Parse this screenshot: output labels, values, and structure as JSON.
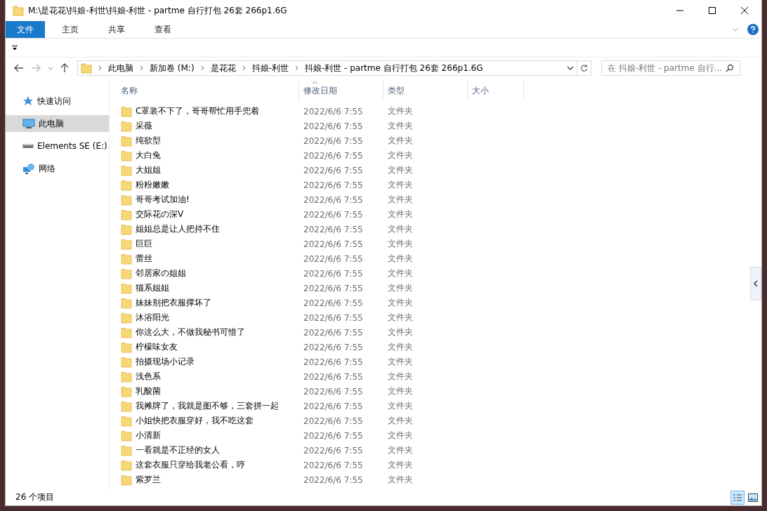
{
  "window": {
    "title": "M:\\是花花\\抖娘-利世\\抖娘-利世 - partme 自行打包 26套 266p1.6G"
  },
  "ribbon": {
    "tabs": [
      {
        "label": "文件",
        "selected": true
      },
      {
        "label": "主页",
        "selected": false
      },
      {
        "label": "共享",
        "selected": false
      },
      {
        "label": "查看",
        "selected": false
      }
    ]
  },
  "address": {
    "crumbs": [
      "此电脑",
      "新加卷 (M:)",
      "是花花",
      "抖娘-利世",
      "抖娘-利世 - partme 自行打包 26套 266p1.6G"
    ]
  },
  "search": {
    "placeholder": "在 抖娘-利世 - partme 自行..."
  },
  "sidebar": {
    "items": [
      {
        "label": "快速访问",
        "kind": "star",
        "selected": false
      },
      {
        "label": "此电脑",
        "kind": "pc",
        "selected": true
      },
      {
        "label": "Elements SE (E:)",
        "kind": "drive",
        "selected": false
      },
      {
        "label": "网络",
        "kind": "network",
        "selected": false
      }
    ]
  },
  "table": {
    "columns": [
      "名称",
      "修改日期",
      "类型",
      "大小"
    ],
    "rows": [
      {
        "name": "C罩装不下了，哥哥帮忙用手兜着",
        "date": "2022/6/6 7:55",
        "type": "文件夹"
      },
      {
        "name": "采薇",
        "date": "2022/6/6 7:55",
        "type": "文件夹"
      },
      {
        "name": "纯欲型",
        "date": "2022/6/6 7:55",
        "type": "文件夹"
      },
      {
        "name": "大白兔",
        "date": "2022/6/6 7:55",
        "type": "文件夹"
      },
      {
        "name": "大姐姐",
        "date": "2022/6/6 7:55",
        "type": "文件夹"
      },
      {
        "name": "粉粉嫩嫩",
        "date": "2022/6/6 7:55",
        "type": "文件夹"
      },
      {
        "name": "哥哥考试加油!",
        "date": "2022/6/6 7:55",
        "type": "文件夹"
      },
      {
        "name": "交际花の深V",
        "date": "2022/6/6 7:55",
        "type": "文件夹"
      },
      {
        "name": "姐姐总是让人把持不住",
        "date": "2022/6/6 7:55",
        "type": "文件夹"
      },
      {
        "name": "巨巨",
        "date": "2022/6/6 7:55",
        "type": "文件夹"
      },
      {
        "name": "蕾丝",
        "date": "2022/6/6 7:55",
        "type": "文件夹"
      },
      {
        "name": "邻居家の姐姐",
        "date": "2022/6/6 7:55",
        "type": "文件夹"
      },
      {
        "name": "猫系姐姐",
        "date": "2022/6/6 7:55",
        "type": "文件夹"
      },
      {
        "name": "妹妹别把衣服撑坏了",
        "date": "2022/6/6 7:55",
        "type": "文件夹"
      },
      {
        "name": "沐浴阳光",
        "date": "2022/6/6 7:55",
        "type": "文件夹"
      },
      {
        "name": "你这么大，不做我秘书可惜了",
        "date": "2022/6/6 7:55",
        "type": "文件夹"
      },
      {
        "name": "柠檬味女友",
        "date": "2022/6/6 7:55",
        "type": "文件夹"
      },
      {
        "name": "拍摄现场小记录",
        "date": "2022/6/6 7:55",
        "type": "文件夹"
      },
      {
        "name": "浅色系",
        "date": "2022/6/6 7:55",
        "type": "文件夹"
      },
      {
        "name": "乳酸菌",
        "date": "2022/6/6 7:55",
        "type": "文件夹"
      },
      {
        "name": "我摊牌了，我就是图不够，三套拼一起",
        "date": "2022/6/6 7:55",
        "type": "文件夹"
      },
      {
        "name": "小姐快把衣服穿好，我不吃这套",
        "date": "2022/6/6 7:55",
        "type": "文件夹"
      },
      {
        "name": "小清新",
        "date": "2022/6/6 7:55",
        "type": "文件夹"
      },
      {
        "name": "一看就是不正经的女人",
        "date": "2022/6/6 7:55",
        "type": "文件夹"
      },
      {
        "name": "这套衣服只穿给我老公看，哼",
        "date": "2022/6/6 7:55",
        "type": "文件夹"
      },
      {
        "name": "紫罗兰",
        "date": "2022/6/6 7:55",
        "type": "文件夹"
      }
    ]
  },
  "status_bar": {
    "item_count": "26 个项目"
  }
}
